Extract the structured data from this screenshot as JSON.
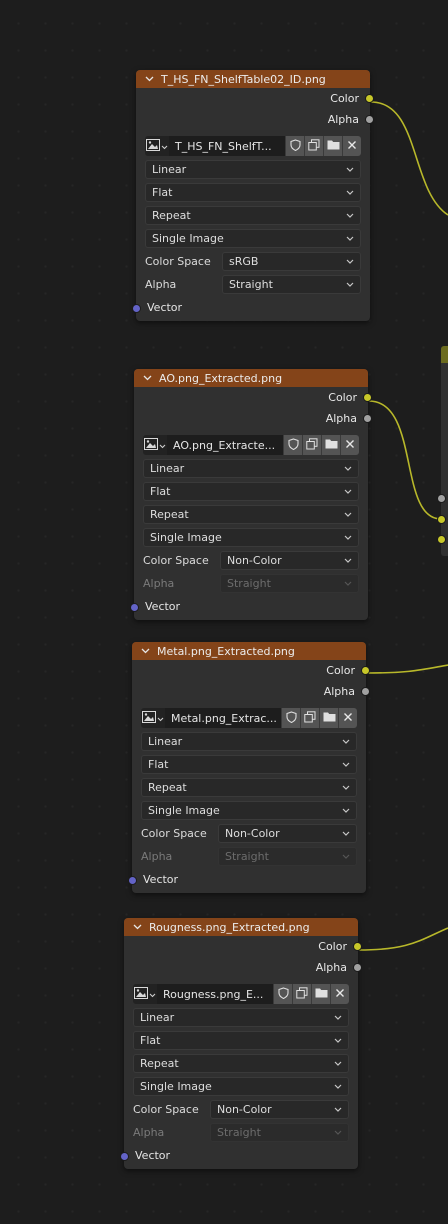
{
  "nodes": [
    {
      "title": "T_HS_FN_ShelfTable02_ID.png",
      "outputs": [
        "Color",
        "Alpha"
      ],
      "image_name": "T_HS_FN_ShelfT...",
      "interpolation": "Linear",
      "projection": "Flat",
      "extension": "Repeat",
      "source": "Single Image",
      "color_space_label": "Color Space",
      "color_space": "sRGB",
      "alpha_label": "Alpha",
      "alpha": "Straight",
      "alpha_disabled": false,
      "input": "Vector"
    },
    {
      "title": "AO.png_Extracted.png",
      "outputs": [
        "Color",
        "Alpha"
      ],
      "image_name": "AO.png_Extracte...",
      "interpolation": "Linear",
      "projection": "Flat",
      "extension": "Repeat",
      "source": "Single Image",
      "color_space_label": "Color Space",
      "color_space": "Non-Color",
      "alpha_label": "Alpha",
      "alpha": "Straight",
      "alpha_disabled": true,
      "input": "Vector"
    },
    {
      "title": "Metal.png_Extracted.png",
      "outputs": [
        "Color",
        "Alpha"
      ],
      "image_name": "Metal.png_Extrac...",
      "interpolation": "Linear",
      "projection": "Flat",
      "extension": "Repeat",
      "source": "Single Image",
      "color_space_label": "Color Space",
      "color_space": "Non-Color",
      "alpha_label": "Alpha",
      "alpha": "Straight",
      "alpha_disabled": true,
      "input": "Vector"
    },
    {
      "title": "Rougness.png_Extracted.png",
      "outputs": [
        "Color",
        "Alpha"
      ],
      "image_name": "Rougness.png_E...",
      "interpolation": "Linear",
      "projection": "Flat",
      "extension": "Repeat",
      "source": "Single Image",
      "color_space_label": "Color Space",
      "color_space": "Non-Color",
      "alpha_label": "Alpha",
      "alpha": "Straight",
      "alpha_disabled": true,
      "input": "Vector"
    }
  ],
  "icons": {
    "image_type": "image-icon",
    "fake_user": "shield-icon",
    "duplicate": "duplicate-icon",
    "open": "folder-icon",
    "unlink": "close-icon"
  },
  "colors": {
    "canvas": "#1d1d1d",
    "node_body": "#303030",
    "texture_header": "#844419",
    "link_yellow": "#c7c729",
    "socket_grey": "#a1a1a1",
    "socket_purple": "#6363c7"
  }
}
